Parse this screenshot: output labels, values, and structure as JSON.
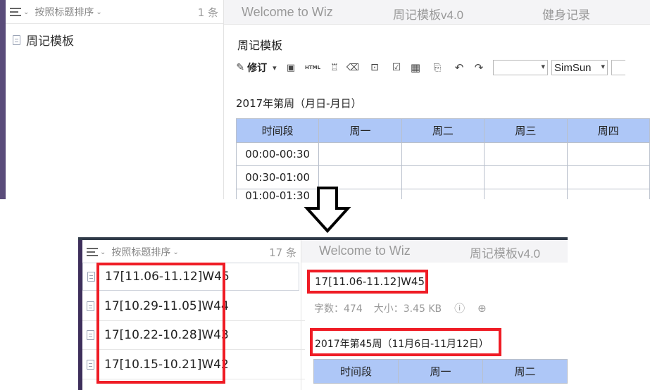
{
  "top": {
    "sort_label": "按照标题排序",
    "count": "1 条",
    "tabs": [
      "Welcome to Wiz",
      "周记模板v4.0",
      "健身记录"
    ],
    "note_item": "周记模板",
    "doc_title": "周记模板",
    "toolbar": {
      "revise_label": "修订",
      "html_label": "HTML",
      "font_name": "SimSun"
    },
    "week_heading": "2017年第周（月日-月日）",
    "table": {
      "headers": [
        "时间段",
        "周一",
        "周二",
        "周三",
        "周四"
      ],
      "rows": [
        "00:00-00:30",
        "00:30-01:00",
        "01:00-01:30"
      ]
    }
  },
  "bottom": {
    "sort_label": "按照标题排序",
    "count": "17 条",
    "tabs": [
      "Welcome to Wiz",
      "周记模板v4.0"
    ],
    "notes": [
      "17[11.06-11.12]W45",
      "17[10.29-11.05]W44",
      "17[10.22-10.28]W43",
      "17[10.15-10.21]W42"
    ],
    "doc_title": "17[11.06-11.12]W45",
    "meta": {
      "words": "字数：474",
      "size": "大小：3.45 KB"
    },
    "week_heading": "2017年第45周（11月6日-11月12日）",
    "table": {
      "headers": [
        "时间段",
        "周一",
        "周二"
      ]
    }
  },
  "colors": {
    "table_header": "#aec7f7",
    "highlight": "#ef1c25",
    "sidebar_strip": "#5a4c7a"
  }
}
